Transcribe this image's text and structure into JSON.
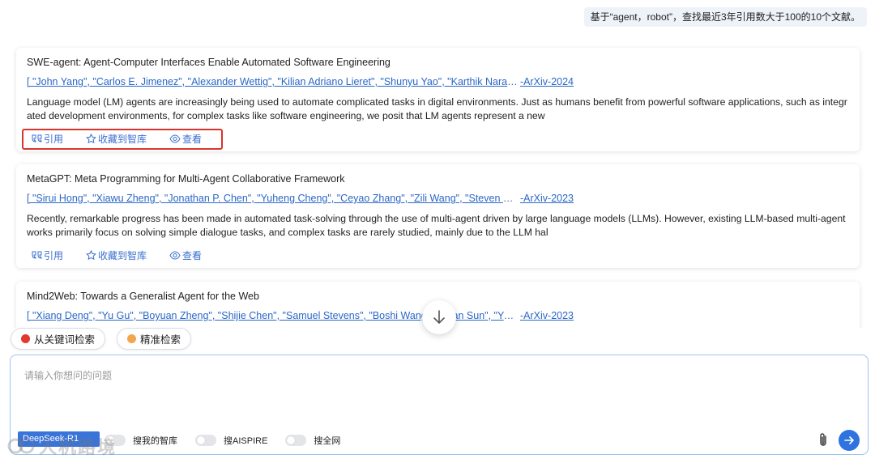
{
  "query": "基于“agent，robot”，查找最近3年引用数大于100的10个文献。",
  "results": [
    {
      "title": "SWE-agent: Agent-Computer Interfaces Enable Automated Software Engineering",
      "authors": "[ \"John Yang\", \"Carlos E. Jimenez\", \"Alexander Wettig\", \"Kilian Adriano Lieret\", \"Shunyu Yao\", \"Karthik Narasimhan\", \"Ofir Press\" ]",
      "source": "-ArXiv-2024",
      "abstract": "Language model (LM) agents are increasingly being used to automate complicated tasks in digital environments. Just as humans benefit from powerful software applications, such as integrated development environments, for complex tasks like software engineering, we posit that LM agents represent a new",
      "actions": {
        "cite": "引用",
        "save": "收藏到智库",
        "view": "查看"
      }
    },
    {
      "title": "MetaGPT: Meta Programming for Multi-Agent Collaborative Framework",
      "authors": "[ \"Sirui Hong\", \"Xiawu Zheng\", \"Jonathan P. Chen\", \"Yuheng Cheng\", \"Ceyao Zhang\", \"Zili Wang\", \"Steven Ka Shing Yau\" ]",
      "source": "-ArXiv-2023",
      "abstract": "Recently, remarkable progress has been made in automated task-solving through the use of multi-agent driven by large language models (LLMs). However, existing LLM-based multi-agent works primarily focus on solving simple dialogue tasks, and complex tasks are rarely studied, mainly due to the LLM hal",
      "actions": {
        "cite": "引用",
        "save": "收藏到智库",
        "view": "查看"
      }
    },
    {
      "title": "Mind2Web: Towards a Generalist Agent for the Web",
      "authors": "[ \"Xiang Deng\", \"Yu Gu\", \"Boyuan Zheng\", \"Shijie Chen\", \"Samuel Stevens\", \"Boshi Wang\", \"Huan Sun\", \"Yu Su\" ]",
      "source": "-ArXiv-2023"
    }
  ],
  "chips": [
    {
      "label": "从关键词检索",
      "color": "#e2382f"
    },
    {
      "label": "精准检索",
      "color": "#f3a64b"
    }
  ],
  "composer": {
    "placeholder": "请输入你想问的问题",
    "model": "DeepSeek-R1",
    "toggles": [
      "搜我的智库",
      "搜AISPIRE",
      "搜全网"
    ]
  },
  "watermark": "人机路境"
}
